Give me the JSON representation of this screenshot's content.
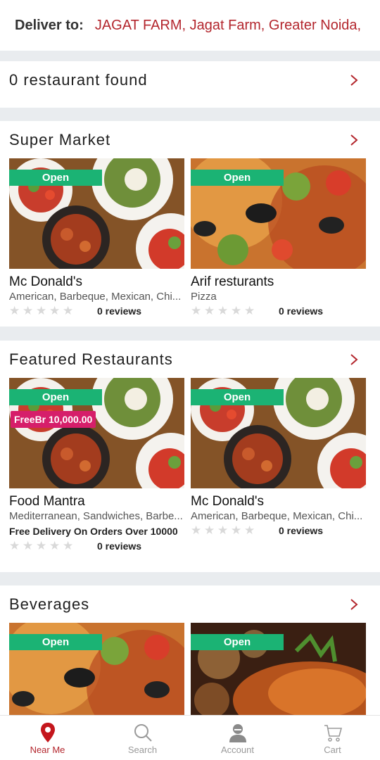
{
  "header": {
    "deliver_label": "Deliver to:",
    "address": "JAGAT FARM, Jagat Farm, Greater Noida,"
  },
  "found": {
    "title": "0 restaurant found"
  },
  "sections": {
    "super_market": {
      "title": "Super Market",
      "cards": [
        {
          "badge": "Open",
          "name": "Mc Donald's",
          "cuisine": "American, Barbeque, Mexican, Chi...",
          "reviews": "0 reviews",
          "rating": 0
        },
        {
          "badge": "Open",
          "name": "Arif resturants",
          "cuisine": "Pizza",
          "reviews": "0 reviews",
          "rating": 0
        }
      ]
    },
    "featured": {
      "title": "Featured Restaurants",
      "cards": [
        {
          "badge": "Open",
          "promo": "FreeBr 10,000.00",
          "name": "Food Mantra",
          "cuisine": "Mediterranean, Sandwiches, Barbe...",
          "delivery": "Free Delivery On Orders Over 10000",
          "reviews": "0 reviews",
          "rating": 0
        },
        {
          "badge": "Open",
          "name": "Mc Donald's",
          "cuisine": "American, Barbeque, Mexican, Chi...",
          "reviews": "0 reviews",
          "rating": 0
        }
      ]
    },
    "beverages": {
      "title": "Beverages",
      "cards": [
        {
          "badge": "Open"
        },
        {
          "badge": "Open"
        }
      ]
    }
  },
  "nav": {
    "items": [
      {
        "label": "Near Me",
        "icon": "location-pin-icon",
        "active": true
      },
      {
        "label": "Search",
        "icon": "search-icon",
        "active": false
      },
      {
        "label": "Account",
        "icon": "user-icon",
        "active": false
      },
      {
        "label": "Cart",
        "icon": "cart-icon",
        "active": false
      }
    ]
  },
  "colors": {
    "accent": "#b3262d",
    "open_badge": "#1bb374",
    "promo_badge": "#d61e6a",
    "divider": "#e9ecef"
  }
}
